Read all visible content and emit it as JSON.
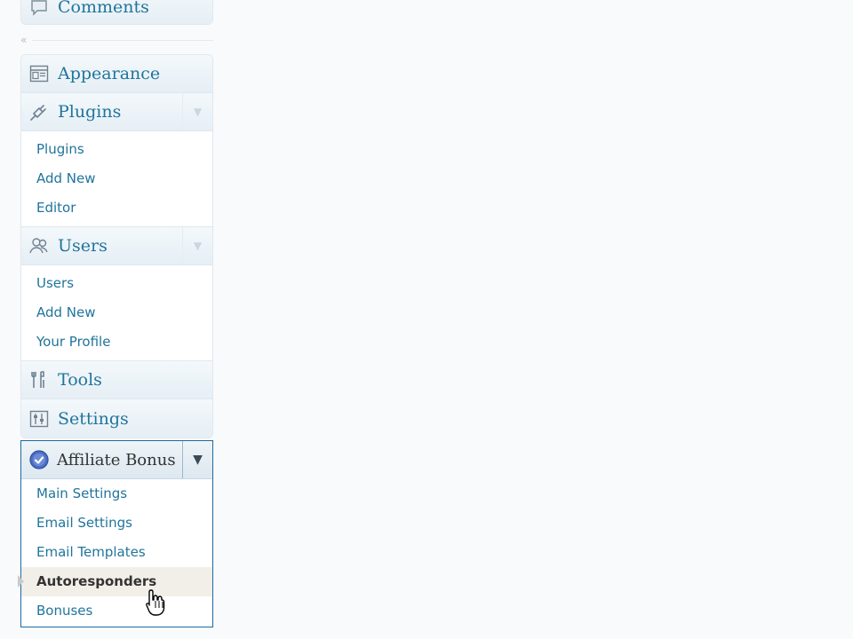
{
  "top_menu": {
    "comments_label": "Comments"
  },
  "collapse": {
    "arrow": "«"
  },
  "menu": {
    "appearance": {
      "label": "Appearance",
      "icon": "appearance-icon"
    },
    "plugins": {
      "label": "Plugins",
      "icon": "plugins-icon",
      "items": [
        "Plugins",
        "Add New",
        "Editor"
      ]
    },
    "users": {
      "label": "Users",
      "icon": "users-icon",
      "items": [
        "Users",
        "Add New",
        "Your Profile"
      ]
    },
    "tools": {
      "label": "Tools",
      "icon": "tools-icon"
    },
    "settings": {
      "label": "Settings",
      "icon": "settings-icon"
    }
  },
  "affiliate_bonus": {
    "label": "Affiliate Bonus",
    "icon": "check-badge-icon",
    "items": [
      "Main Settings",
      "Email Settings",
      "Email Templates",
      "Autoresponders",
      "Bonuses"
    ],
    "current": "Autoresponders"
  },
  "colors": {
    "link": "#21759b",
    "active_border": "#1c6aa0",
    "current_bg": "#f1efe8"
  }
}
